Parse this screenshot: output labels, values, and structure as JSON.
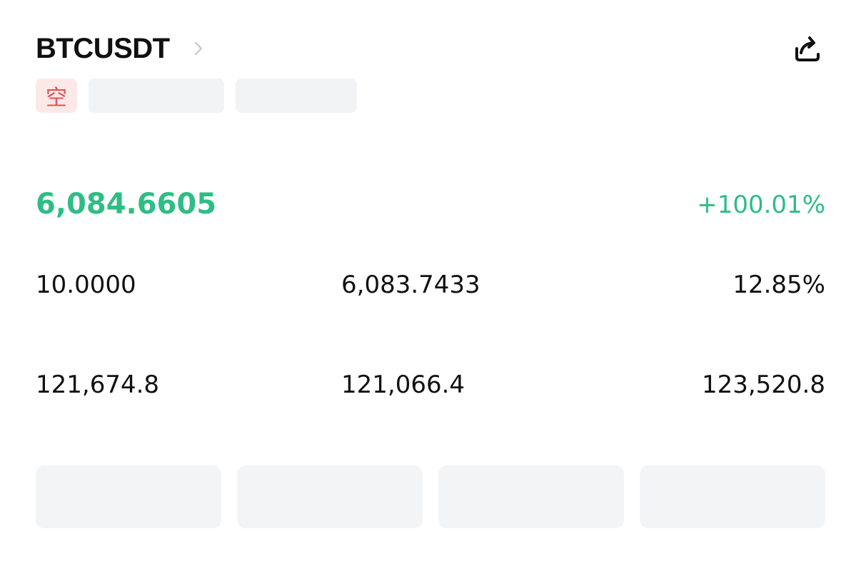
{
  "header": {
    "symbol": "BTCUSDT",
    "share_icon": "share-icon",
    "chevron_icon": "chevron-right-icon"
  },
  "tags": {
    "side": "空",
    "meta_1": "",
    "meta_2": ""
  },
  "summary": {
    "pnl_label": "",
    "pnl_value": "6,084.6605",
    "roe_label": "",
    "roe_value": "+100.01%"
  },
  "stats": {
    "row1": [
      {
        "label": "",
        "value": "10.0000"
      },
      {
        "label": "",
        "value": "6,083.7433"
      },
      {
        "label": "",
        "value": "12.85%"
      }
    ],
    "row2": [
      {
        "label": "",
        "value": "121,674.8"
      },
      {
        "label": "",
        "value": "121,066.4"
      },
      {
        "label": "",
        "value": "123,520.8"
      }
    ]
  },
  "actions": [
    {
      "label": ""
    },
    {
      "label": ""
    },
    {
      "label": ""
    },
    {
      "label": ""
    }
  ],
  "colors": {
    "profit_green": "#2ebd85",
    "short_red": "#e05454",
    "short_bg": "#fde8e8"
  }
}
